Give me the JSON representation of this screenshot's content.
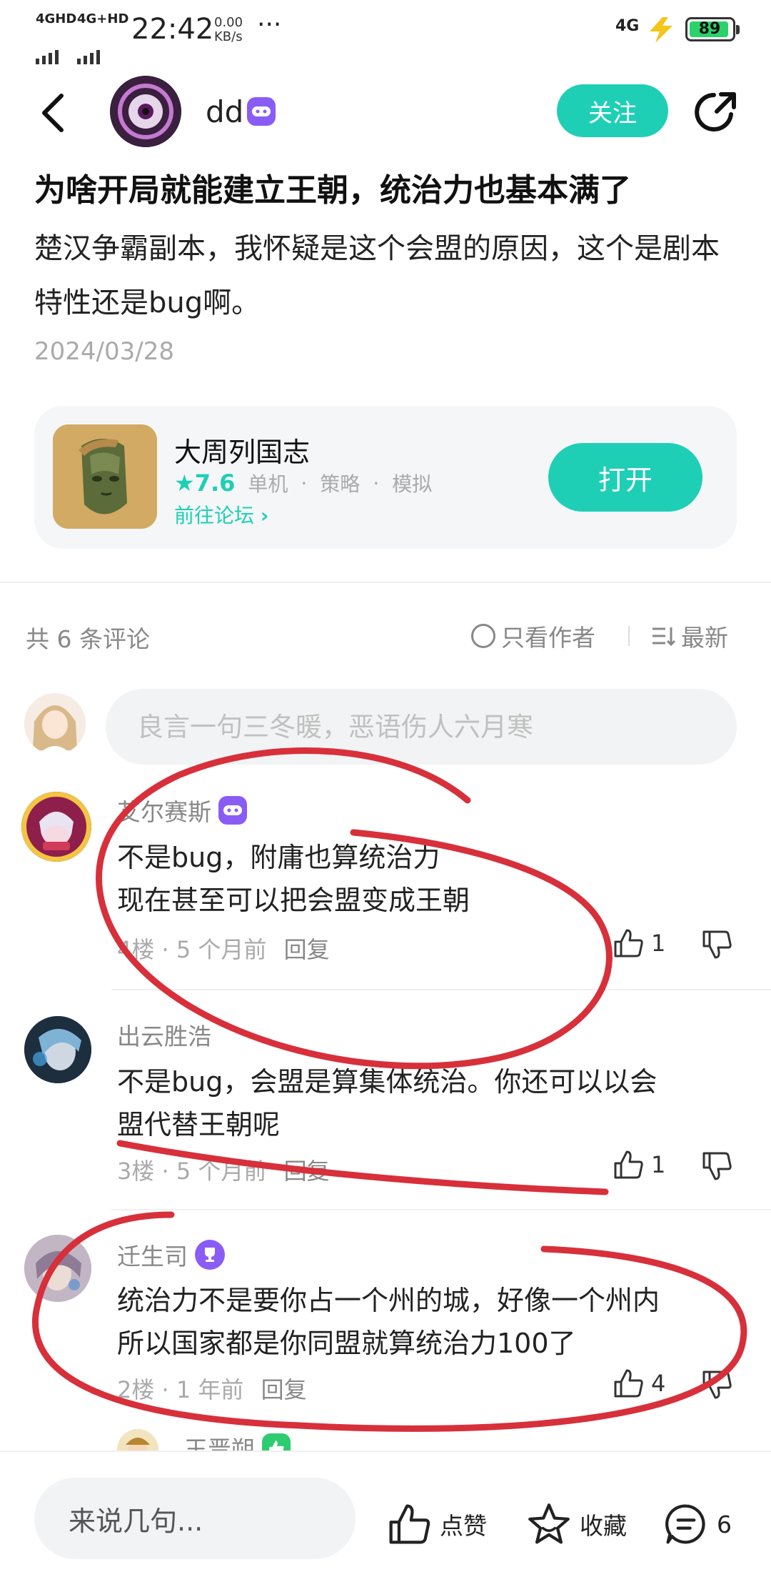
{
  "status_bar": {
    "net1": "4GHD",
    "net2": "4G+HD",
    "time": "22:42",
    "speed_value": "0.00",
    "speed_unit": "KB/s",
    "dots": "···",
    "net_right": "4G",
    "battery": "89"
  },
  "header": {
    "username": "dd",
    "follow_label": "关注"
  },
  "post": {
    "title": "为啥开局就能建立王朝，统治力也基本满了",
    "body": "楚汉争霸副本，我怀疑是这个会盟的原因，这个是剧本特性还是bug啊。",
    "date": "2024/03/28"
  },
  "game_card": {
    "name": "大周列国志",
    "rating": "7.6",
    "tags": [
      "单机",
      "策略",
      "模拟"
    ],
    "forum_link": "前往论坛",
    "open_label": "打开"
  },
  "comments_header": {
    "count_text": "共 6 条评论",
    "only_author": "只看作者",
    "sort": "最新"
  },
  "comment_input": {
    "placeholder": "良言一句三冬暖，恶语伤人六月寒"
  },
  "comments": [
    {
      "name": "艾尔赛斯",
      "text_line1": "不是bug，附庸也算统治力",
      "text_line2": "现在甚至可以把会盟变成王朝",
      "floor": "4楼",
      "time": "5 个月前",
      "reply": "回复",
      "likes": "1"
    },
    {
      "name": "出云胜浩",
      "text_line1": "不是bug，会盟是算集体统治。你还可以以会",
      "text_line2": "盟代替王朝呢",
      "floor": "3楼",
      "time": "5 个月前",
      "reply": "回复",
      "likes": "1"
    },
    {
      "name": "迁生司",
      "text_line1": "统治力不是要你占一个州的城，好像一个州内",
      "text_line2": "所以国家都是你同盟就算统治力100了",
      "floor": "2楼",
      "time": "1 年前",
      "reply": "回复",
      "likes": "4"
    },
    {
      "name": "王晋朔"
    }
  ],
  "bottom_bar": {
    "input_label": "来说几句...",
    "like_label": "点赞",
    "fav_label": "收藏",
    "comment_count": "6"
  },
  "colors": {
    "accent": "#1ecfb6",
    "annotation_red": "#d7303b",
    "badge_purple": "#8a5cf6",
    "badge_green": "#2ecc71"
  }
}
